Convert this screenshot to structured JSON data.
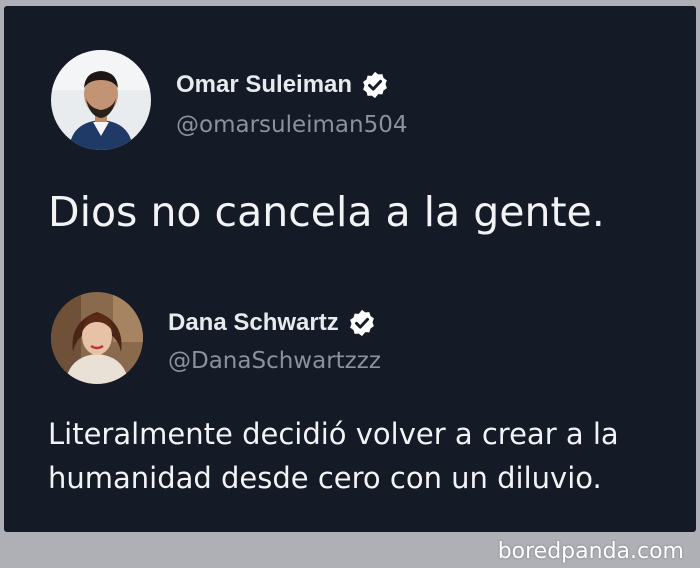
{
  "tweet1": {
    "name": "Omar Suleiman",
    "handle": "@omarsuleiman504",
    "text": "Dios no cancela a la gente.",
    "verified_icon": "verified-badge-icon"
  },
  "tweet2": {
    "name": "Dana Schwartz",
    "handle": "@DanaSchwartzzz",
    "text_line1": "Literalmente decidió volver a crear a la",
    "text_line2": "humanidad desde cero con un diluvio.",
    "verified_icon": "verified-badge-icon"
  },
  "footer": {
    "watermark": "boredpanda.com"
  },
  "colors": {
    "card_bg": "#141a26",
    "page_bg": "#aeb0b6",
    "name": "#e8ebee",
    "handle": "#8a929c"
  }
}
